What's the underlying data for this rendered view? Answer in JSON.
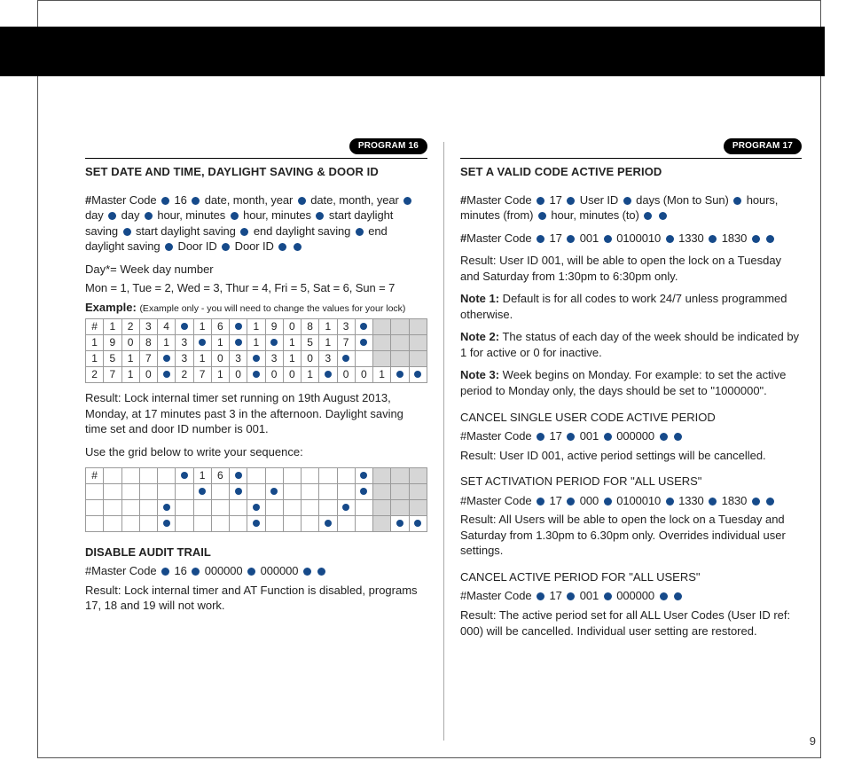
{
  "page_number": "9",
  "left": {
    "badge": "PROGRAM 16",
    "title": "SET DATE AND TIME, DAYLIGHT SAVING & DOOR ID",
    "seq_tokens": [
      {
        "t": "b",
        "v": "#"
      },
      {
        "t": "x",
        "v": "Master Code "
      },
      {
        "t": "d"
      },
      {
        "t": "x",
        "v": " 16 "
      },
      {
        "t": "d"
      },
      {
        "t": "x",
        "v": " date, month, year "
      },
      {
        "t": "d"
      },
      {
        "t": "x",
        "v": " date, month, year "
      },
      {
        "t": "d"
      },
      {
        "t": "x",
        "v": " day "
      },
      {
        "t": "d"
      },
      {
        "t": "x",
        "v": " day "
      },
      {
        "t": "d"
      },
      {
        "t": "x",
        "v": " hour, minutes "
      },
      {
        "t": "d"
      },
      {
        "t": "x",
        "v": " hour, minutes "
      },
      {
        "t": "d"
      },
      {
        "t": "x",
        "v": " start daylight saving "
      },
      {
        "t": "d"
      },
      {
        "t": "x",
        "v": " start daylight saving "
      },
      {
        "t": "d"
      },
      {
        "t": "x",
        "v": " end daylight saving "
      },
      {
        "t": "d"
      },
      {
        "t": "x",
        "v": " end daylight saving "
      },
      {
        "t": "d"
      },
      {
        "t": "x",
        "v": " Door ID "
      },
      {
        "t": "d"
      },
      {
        "t": "x",
        "v": " Door ID "
      },
      {
        "t": "d"
      },
      {
        "t": "x",
        "v": " "
      },
      {
        "t": "d"
      }
    ],
    "day_note": "Day*= Week day number",
    "day_map": "Mon = 1, Tue = 2, Wed = 3, Thur = 4, Fri = 5, Sat = 6, Sun = 7",
    "example_label": "Example:",
    "example_note": "(Example only - you will need to change the values for your lock)",
    "grid1": [
      [
        "#",
        "1",
        "2",
        "3",
        "4",
        "●",
        "1",
        "6",
        "●",
        "1",
        "9",
        "0",
        "8",
        "1",
        "3",
        "●",
        "",
        "",
        ""
      ],
      [
        "1",
        "9",
        "0",
        "8",
        "1",
        "3",
        "●",
        "1",
        "●",
        "1",
        "●",
        "1",
        "5",
        "1",
        "7",
        "●",
        "",
        "",
        ""
      ],
      [
        "1",
        "5",
        "1",
        "7",
        "●",
        "3",
        "1",
        "0",
        "3",
        "●",
        "3",
        "1",
        "0",
        "3",
        "●",
        "",
        "",
        "",
        ""
      ],
      [
        "2",
        "7",
        "1",
        "0",
        "●",
        "2",
        "7",
        "1",
        "0",
        "●",
        "0",
        "0",
        "1",
        "●",
        "0",
        "0",
        "1",
        "●",
        "●"
      ]
    ],
    "result_label": "Result:",
    "result_text": " Lock internal timer set running on 19th August 2013, Monday, at 17 minutes past 3 in the afternoon. Daylight saving time set and door ID number is 001.",
    "blank_intro": "Use the grid below to write your sequence:",
    "grid2": [
      [
        "#",
        "",
        "",
        "",
        "",
        "●",
        "1",
        "6",
        "●",
        "",
        "",
        "",
        "",
        "",
        "",
        "●",
        "",
        "",
        ""
      ],
      [
        "",
        "",
        "",
        "",
        "",
        "",
        "●",
        "",
        "●",
        "",
        "●",
        "",
        "",
        "",
        "",
        "●",
        "",
        "",
        ""
      ],
      [
        "",
        "",
        "",
        "",
        "●",
        "",
        "",
        "",
        "",
        "●",
        "",
        "",
        "",
        "",
        "●",
        "",
        "",
        "",
        ""
      ],
      [
        "",
        "",
        "",
        "",
        "●",
        "",
        "",
        "",
        "",
        "●",
        "",
        "",
        "",
        "●",
        "",
        "",
        "",
        "●",
        "●"
      ]
    ],
    "disable_title": "DISABLE AUDIT TRAIL",
    "disable_tokens": [
      {
        "t": "x",
        "v": "#Master Code "
      },
      {
        "t": "d"
      },
      {
        "t": "x",
        "v": " 16 "
      },
      {
        "t": "d"
      },
      {
        "t": "x",
        "v": " 000000 "
      },
      {
        "t": "d"
      },
      {
        "t": "x",
        "v": " 000000 "
      },
      {
        "t": "d"
      },
      {
        "t": "x",
        "v": " "
      },
      {
        "t": "d"
      }
    ],
    "disable_result": " Lock internal timer and AT Function is disabled, programs 17, 18 and 19 will not work."
  },
  "right": {
    "badge": "PROGRAM 17",
    "title": "SET A VALID CODE ACTIVE PERIOD",
    "seq1_tokens": [
      {
        "t": "b",
        "v": "#"
      },
      {
        "t": "x",
        "v": "Master Code "
      },
      {
        "t": "d"
      },
      {
        "t": "x",
        "v": " 17 "
      },
      {
        "t": "d"
      },
      {
        "t": "x",
        "v": " User ID "
      },
      {
        "t": "d"
      },
      {
        "t": "x",
        "v": " days (Mon to Sun) "
      },
      {
        "t": "d"
      },
      {
        "t": "x",
        "v": " hours, minutes (from) "
      },
      {
        "t": "d"
      },
      {
        "t": "x",
        "v": "  hour, minutes (to) "
      },
      {
        "t": "d"
      },
      {
        "t": "x",
        "v": " "
      },
      {
        "t": "d"
      }
    ],
    "seq2_tokens": [
      {
        "t": "b",
        "v": "#"
      },
      {
        "t": "x",
        "v": "Master Code "
      },
      {
        "t": "d"
      },
      {
        "t": "x",
        "v": " 17 "
      },
      {
        "t": "d"
      },
      {
        "t": "x",
        "v": " 001 "
      },
      {
        "t": "d"
      },
      {
        "t": "x",
        "v": " 0100010 "
      },
      {
        "t": "d"
      },
      {
        "t": "x",
        "v": " 1330 "
      },
      {
        "t": "d"
      },
      {
        "t": "x",
        "v": " 1830 "
      },
      {
        "t": "d"
      },
      {
        "t": "x",
        "v": " "
      },
      {
        "t": "d"
      }
    ],
    "result_label": "Result:",
    "result_text": " User ID 001, will be able to open the lock on a Tuesday and Saturday from 1:30pm to 6:30pm only.",
    "note1_label": "Note 1:",
    "note1_text": " Default is for all codes to work 24/7 unless programmed otherwise.",
    "note2_label": "Note 2:",
    "note2_text": " The status of each day of the week should be indicated by 1 for active or 0 for inactive.",
    "note3_label": "Note 3:",
    "note3_text": " Week begins on Monday. For example: to set the active period to Monday only, the days should be set to \"1000000\".",
    "cancel_single_title": "CANCEL SINGLE USER CODE ACTIVE PERIOD",
    "cancel_single_tokens": [
      {
        "t": "x",
        "v": "#Master Code "
      },
      {
        "t": "d"
      },
      {
        "t": "x",
        "v": " 17 "
      },
      {
        "t": "d"
      },
      {
        "t": "x",
        "v": " 001 "
      },
      {
        "t": "d"
      },
      {
        "t": "x",
        "v": " 000000 "
      },
      {
        "t": "d"
      },
      {
        "t": "x",
        "v": " "
      },
      {
        "t": "d"
      }
    ],
    "cancel_single_result": " User ID 001, active period settings will be cancelled.",
    "set_all_title": "SET ACTIVATION PERIOD FOR \"ALL USERS\"",
    "set_all_tokens": [
      {
        "t": "x",
        "v": "#Master Code "
      },
      {
        "t": "d"
      },
      {
        "t": "x",
        "v": " 17 "
      },
      {
        "t": "d"
      },
      {
        "t": "x",
        "v": " 000 "
      },
      {
        "t": "d"
      },
      {
        "t": "x",
        "v": " 0100010 "
      },
      {
        "t": "d"
      },
      {
        "t": "x",
        "v": " 1330 "
      },
      {
        "t": "d"
      },
      {
        "t": "x",
        "v": " 1830 "
      },
      {
        "t": "d"
      },
      {
        "t": "x",
        "v": " "
      },
      {
        "t": "d"
      }
    ],
    "set_all_result": " All Users will be able to open the lock on a Tuesday and Saturday from 1.30pm to 6.30pm only. Overrides individual user settings.",
    "cancel_all_title": "CANCEL ACTIVE PERIOD FOR \"ALL USERS\"",
    "cancel_all_tokens": [
      {
        "t": "x",
        "v": "#Master Code "
      },
      {
        "t": "d"
      },
      {
        "t": "x",
        "v": " 17 "
      },
      {
        "t": "d"
      },
      {
        "t": "x",
        "v": " 001 "
      },
      {
        "t": "d"
      },
      {
        "t": "x",
        "v": " 000000 "
      },
      {
        "t": "d"
      },
      {
        "t": "x",
        "v": " "
      },
      {
        "t": "d"
      }
    ],
    "cancel_all_result": " The active period set for all ALL User Codes (User ID ref: 000) will be cancelled. Individual user setting are restored."
  }
}
